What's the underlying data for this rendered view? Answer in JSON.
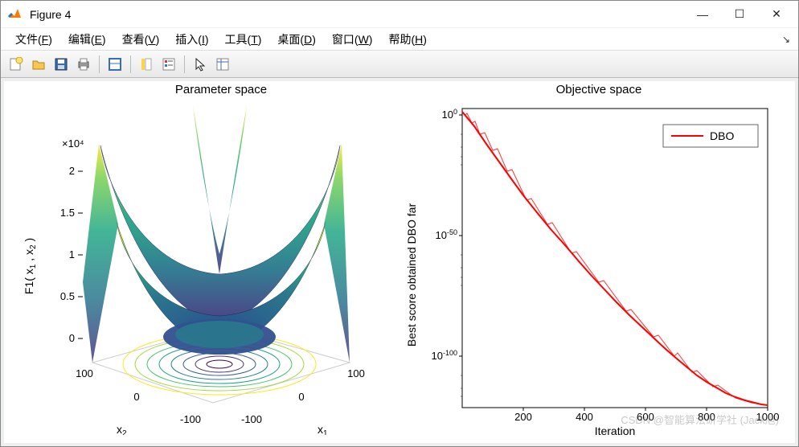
{
  "window": {
    "title": "Figure 4",
    "minimize": "—",
    "maximize": "☐",
    "close": "✕"
  },
  "menu": {
    "file": "文件(F)",
    "edit": "编辑(E)",
    "view": "查看(V)",
    "insert": "插入(I)",
    "tools": "工具(T)",
    "desktop": "桌面(D)",
    "window": "窗口(W)",
    "help": "帮助(H)"
  },
  "toolbar_icons": {
    "new": "new-figure-icon",
    "open": "open-icon",
    "save": "save-icon",
    "print": "print-icon",
    "inspect": "inspect-icon",
    "colorbar": "colorbar-icon",
    "legend": "legend-icon",
    "pointer": "pointer-icon",
    "datacursor": "datacursor-icon"
  },
  "chart_left": {
    "title": "Parameter space",
    "zlabel": "F1( x₁ , x₂ )",
    "z_exponent": "×10⁴",
    "xlabel": "x₁",
    "ylabel": "x₂",
    "x_ticks": [
      "-100",
      "0",
      "100"
    ],
    "y_ticks": [
      "-100",
      "0",
      "100"
    ],
    "z_ticks": [
      "0",
      "0.5",
      "1",
      "1.5",
      "2"
    ]
  },
  "chart_right": {
    "title": "Objective space",
    "xlabel": "Iteration",
    "ylabel": "Best score obtained DBO far",
    "x_ticks": [
      "200",
      "400",
      "600",
      "800",
      "1000"
    ],
    "y_ticks": [
      "10⁻¹⁰⁰",
      "10⁻⁵⁰",
      "10⁰"
    ],
    "legend": {
      "label": "DBO",
      "color": "#ff0000"
    }
  },
  "watermark": "CSDN @智能算法研学社 (Jack旭)",
  "chart_data": [
    {
      "type": "surface",
      "title": "Parameter space",
      "function": "F1(x1,x2) = x1^2 + x2^2 (sphere-like)",
      "xlabel": "x1",
      "xlim": [
        -100,
        100
      ],
      "ylabel": "x2",
      "ylim": [
        -100,
        100
      ],
      "zlabel": "F1(x1,x2)",
      "zlim": [
        0,
        20000
      ],
      "colormap": "viridis",
      "contour_on_floor": true
    },
    {
      "type": "line",
      "title": "Objective space",
      "xlabel": "Iteration",
      "xlim": [
        0,
        1000
      ],
      "ylabel": "Best score obtained DBO far",
      "yscale": "log",
      "ylim": [
        1e-120,
        10
      ],
      "series": [
        {
          "name": "DBO",
          "color": "#ff0000",
          "x": [
            0,
            50,
            100,
            150,
            200,
            250,
            300,
            350,
            400,
            450,
            500,
            550,
            600,
            650,
            700,
            750,
            800,
            850,
            900,
            950,
            1000
          ],
          "y": [
            5,
            1e-06,
            1e-14,
            1e-21,
            1e-28,
            1e-35,
            1e-42,
            1e-49,
            1e-56,
            1e-63,
            1e-70,
            1e-77,
            1e-83,
            1e-90,
            1e-97,
            1e-103,
            1e-108,
            1e-112,
            1e-116,
            1e-118,
            1e-119
          ]
        }
      ]
    }
  ]
}
